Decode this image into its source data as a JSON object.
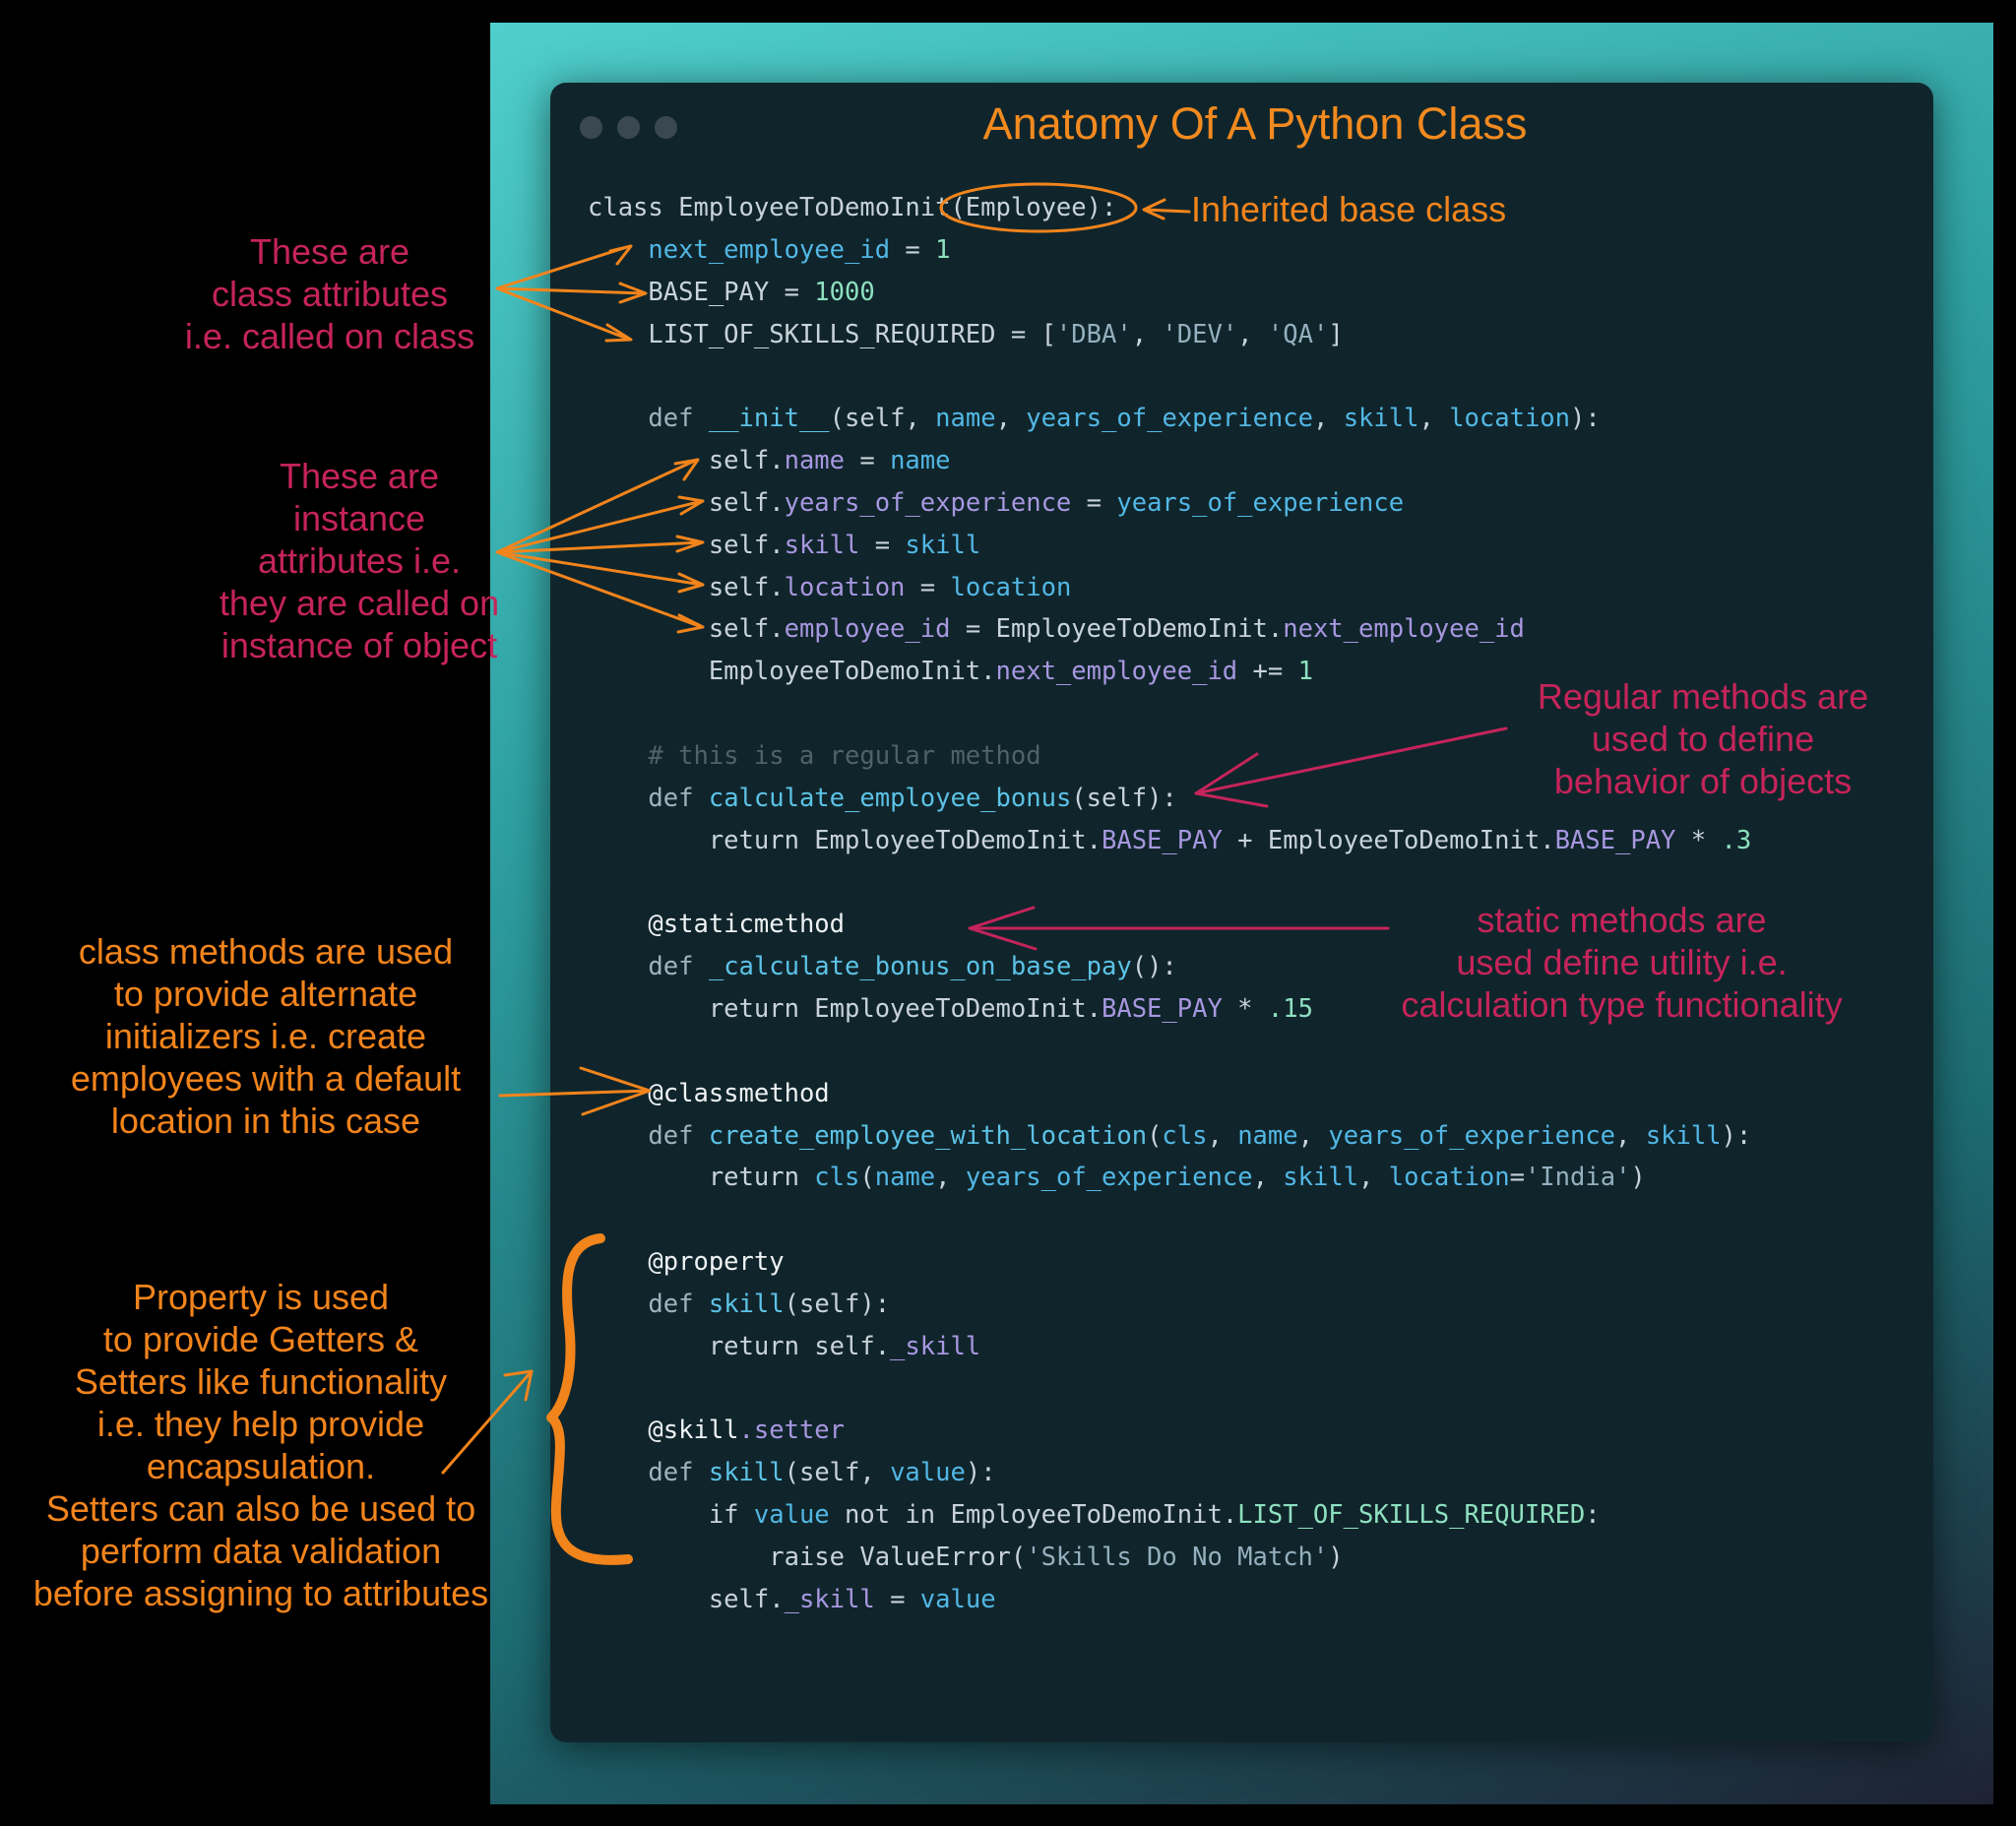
{
  "window": {
    "title": "Anatomy Of A Python Class"
  },
  "code_lines": [
    [
      {
        "t": "class EmployeeToDemoInit(Employee):",
        "c": "pl"
      }
    ],
    [
      {
        "t": "    ",
        "c": "pl"
      },
      {
        "t": "next_employee_id",
        "c": "vr"
      },
      {
        "t": " = ",
        "c": "pl"
      },
      {
        "t": "1",
        "c": "nm"
      }
    ],
    [
      {
        "t": "    BASE_PAY = ",
        "c": "pl"
      },
      {
        "t": "1000",
        "c": "nm"
      }
    ],
    [
      {
        "t": "    LIST_OF_SKILLS_REQUIRED = [",
        "c": "pl"
      },
      {
        "t": "'DBA'",
        "c": "st"
      },
      {
        "t": ", ",
        "c": "pl"
      },
      {
        "t": "'DEV'",
        "c": "st"
      },
      {
        "t": ", ",
        "c": "pl"
      },
      {
        "t": "'QA'",
        "c": "st"
      },
      {
        "t": "]",
        "c": "pl"
      }
    ],
    [],
    [
      {
        "t": "    ",
        "c": "pl"
      },
      {
        "t": "def ",
        "c": "kw"
      },
      {
        "t": "__init__",
        "c": "fn"
      },
      {
        "t": "(self, ",
        "c": "pl"
      },
      {
        "t": "name",
        "c": "vr"
      },
      {
        "t": ", ",
        "c": "pl"
      },
      {
        "t": "years_of_experience",
        "c": "vr"
      },
      {
        "t": ", ",
        "c": "pl"
      },
      {
        "t": "skill",
        "c": "vr"
      },
      {
        "t": ", ",
        "c": "pl"
      },
      {
        "t": "location",
        "c": "vr"
      },
      {
        "t": "):",
        "c": "pl"
      }
    ],
    [
      {
        "t": "        self.",
        "c": "pl"
      },
      {
        "t": "name",
        "c": "at"
      },
      {
        "t": " = ",
        "c": "pl"
      },
      {
        "t": "name",
        "c": "vr"
      }
    ],
    [
      {
        "t": "        self.",
        "c": "pl"
      },
      {
        "t": "years_of_experience",
        "c": "at"
      },
      {
        "t": " = ",
        "c": "pl"
      },
      {
        "t": "years_of_experience",
        "c": "vr"
      }
    ],
    [
      {
        "t": "        self.",
        "c": "pl"
      },
      {
        "t": "skill",
        "c": "at"
      },
      {
        "t": " = ",
        "c": "pl"
      },
      {
        "t": "skill",
        "c": "vr"
      }
    ],
    [
      {
        "t": "        self.",
        "c": "pl"
      },
      {
        "t": "location",
        "c": "at"
      },
      {
        "t": " = ",
        "c": "pl"
      },
      {
        "t": "location",
        "c": "vr"
      }
    ],
    [
      {
        "t": "        self.",
        "c": "pl"
      },
      {
        "t": "employee_id",
        "c": "at"
      },
      {
        "t": " = EmployeeToDemoInit.",
        "c": "pl"
      },
      {
        "t": "next_employee_id",
        "c": "at"
      }
    ],
    [
      {
        "t": "        EmployeeToDemoInit.",
        "c": "pl"
      },
      {
        "t": "next_employee_id",
        "c": "at"
      },
      {
        "t": " += ",
        "c": "pl"
      },
      {
        "t": "1",
        "c": "nm"
      }
    ],
    [],
    [
      {
        "t": "    # this is a regular method",
        "c": "cm"
      }
    ],
    [
      {
        "t": "    ",
        "c": "pl"
      },
      {
        "t": "def ",
        "c": "kw"
      },
      {
        "t": "calculate_employee_bonus",
        "c": "fn"
      },
      {
        "t": "(self):",
        "c": "pl"
      }
    ],
    [
      {
        "t": "        return EmployeeToDemoInit.",
        "c": "pl"
      },
      {
        "t": "BASE_PAY",
        "c": "at"
      },
      {
        "t": " + EmployeeToDemoInit.",
        "c": "pl"
      },
      {
        "t": "BASE_PAY",
        "c": "at"
      },
      {
        "t": " * ",
        "c": "pl"
      },
      {
        "t": ".3",
        "c": "nm"
      }
    ],
    [],
    [
      {
        "t": "    ",
        "c": "pl"
      },
      {
        "t": "@staticmethod",
        "c": "dc"
      }
    ],
    [
      {
        "t": "    ",
        "c": "pl"
      },
      {
        "t": "def ",
        "c": "kw"
      },
      {
        "t": "_calculate_bonus_on_base_pay",
        "c": "fn"
      },
      {
        "t": "():",
        "c": "pl"
      }
    ],
    [
      {
        "t": "        return EmployeeToDemoInit.",
        "c": "pl"
      },
      {
        "t": "BASE_PAY",
        "c": "at"
      },
      {
        "t": " * ",
        "c": "pl"
      },
      {
        "t": ".15",
        "c": "nm"
      }
    ],
    [],
    [
      {
        "t": "    ",
        "c": "pl"
      },
      {
        "t": "@classmethod",
        "c": "dc"
      }
    ],
    [
      {
        "t": "    ",
        "c": "pl"
      },
      {
        "t": "def ",
        "c": "kw"
      },
      {
        "t": "create_employee_with_location",
        "c": "fn"
      },
      {
        "t": "(",
        "c": "pl"
      },
      {
        "t": "cls",
        "c": "vr"
      },
      {
        "t": ", ",
        "c": "pl"
      },
      {
        "t": "name",
        "c": "vr"
      },
      {
        "t": ", ",
        "c": "pl"
      },
      {
        "t": "years_of_experience",
        "c": "vr"
      },
      {
        "t": ", ",
        "c": "pl"
      },
      {
        "t": "skill",
        "c": "vr"
      },
      {
        "t": "):",
        "c": "pl"
      }
    ],
    [
      {
        "t": "        return ",
        "c": "pl"
      },
      {
        "t": "cls",
        "c": "vr"
      },
      {
        "t": "(",
        "c": "pl"
      },
      {
        "t": "name",
        "c": "vr"
      },
      {
        "t": ", ",
        "c": "pl"
      },
      {
        "t": "years_of_experience",
        "c": "vr"
      },
      {
        "t": ", ",
        "c": "pl"
      },
      {
        "t": "skill",
        "c": "vr"
      },
      {
        "t": ", ",
        "c": "pl"
      },
      {
        "t": "location",
        "c": "vr"
      },
      {
        "t": "=",
        "c": "pl"
      },
      {
        "t": "'India'",
        "c": "st"
      },
      {
        "t": ")",
        "c": "pl"
      }
    ],
    [],
    [
      {
        "t": "    ",
        "c": "pl"
      },
      {
        "t": "@property",
        "c": "dc"
      }
    ],
    [
      {
        "t": "    ",
        "c": "pl"
      },
      {
        "t": "def ",
        "c": "kw"
      },
      {
        "t": "skill",
        "c": "fn"
      },
      {
        "t": "(self):",
        "c": "pl"
      }
    ],
    [
      {
        "t": "        return self.",
        "c": "pl"
      },
      {
        "t": "_skill",
        "c": "at"
      }
    ],
    [],
    [
      {
        "t": "    ",
        "c": "pl"
      },
      {
        "t": "@skill",
        "c": "dc"
      },
      {
        "t": ".setter",
        "c": "at"
      }
    ],
    [
      {
        "t": "    ",
        "c": "pl"
      },
      {
        "t": "def ",
        "c": "kw"
      },
      {
        "t": "skill",
        "c": "fn"
      },
      {
        "t": "(self, ",
        "c": "pl"
      },
      {
        "t": "value",
        "c": "vr"
      },
      {
        "t": "):",
        "c": "pl"
      }
    ],
    [
      {
        "t": "        if ",
        "c": "pl"
      },
      {
        "t": "value",
        "c": "vr"
      },
      {
        "t": " not in EmployeeToDemoInit.",
        "c": "pl"
      },
      {
        "t": "LIST_OF_SKILLS_REQUIRED",
        "c": "nm"
      },
      {
        "t": ":",
        "c": "pl"
      }
    ],
    [
      {
        "t": "            raise ValueError(",
        "c": "pl"
      },
      {
        "t": "'Skills Do No Match'",
        "c": "st"
      },
      {
        "t": ")",
        "c": "pl"
      }
    ],
    [
      {
        "t": "        self.",
        "c": "pl"
      },
      {
        "t": "_skill",
        "c": "at"
      },
      {
        "t": " = ",
        "c": "pl"
      },
      {
        "t": "value",
        "c": "vr"
      }
    ]
  ],
  "annotations": {
    "inherited": "Inherited base class",
    "class_attributes": "These are\nclass attributes\ni.e. called on class",
    "instance_attributes": "These are\ninstance\nattributes i.e.\nthey are called on\ninstance of object",
    "regular_methods": "Regular methods are\nused to define\nbehavior of objects",
    "static_methods": "static methods are\nused define utility i.e.\ncalculation type functionality",
    "class_methods": "class methods are used\nto provide alternate\ninitializers i.e. create\nemployees with a default\nlocation in this case",
    "property": "Property is used\nto provide Getters &\nSetters like functionality\ni.e. they help provide\nencapsulation.\nSetters can also be used to\nperform data validation\nbefore assigning to attributes"
  },
  "colors": {
    "orange": "#f2841c",
    "crimson": "#c5245a",
    "window_bg": "#10252b"
  }
}
